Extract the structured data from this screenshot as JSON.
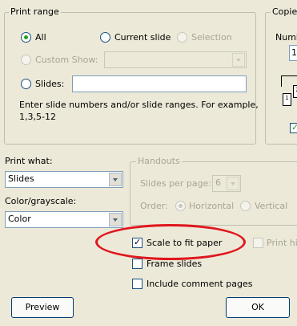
{
  "print_range": {
    "legend": "Print range",
    "all_label": "All",
    "current_slide_label": "Current slide",
    "selection_label": "Selection",
    "custom_show_label": "Custom Show:",
    "slides_label": "Slides:",
    "help_text_line1": "Enter slide numbers and/or slide ranges. For example,",
    "help_text_line2": "1,3,5-12"
  },
  "copies": {
    "legend": "Copies",
    "number_label": "Numb",
    "number_value": "1",
    "collate_pages": [
      "1",
      "2"
    ]
  },
  "print_what": {
    "label": "Print what:",
    "value": "Slides"
  },
  "color": {
    "label": "Color/grayscale:",
    "value": "Color"
  },
  "handouts": {
    "legend": "Handouts",
    "slides_per_page_label": "Slides per page:",
    "slides_per_page_value": "6",
    "order_label": "Order:",
    "horizontal_label": "Horizontal",
    "vertical_label": "Vertical"
  },
  "options": {
    "scale_label": "Scale to fit paper",
    "scale_checked": true,
    "frame_label": "Frame slides",
    "frame_checked": false,
    "comments_label": "Include comment pages",
    "comments_checked": false,
    "print_hidden_label": "Print hi"
  },
  "buttons": {
    "preview": "Preview",
    "ok": "OK"
  },
  "colors": {
    "accent_check": "#21a121",
    "highlight_ellipse": "#e0161d"
  }
}
